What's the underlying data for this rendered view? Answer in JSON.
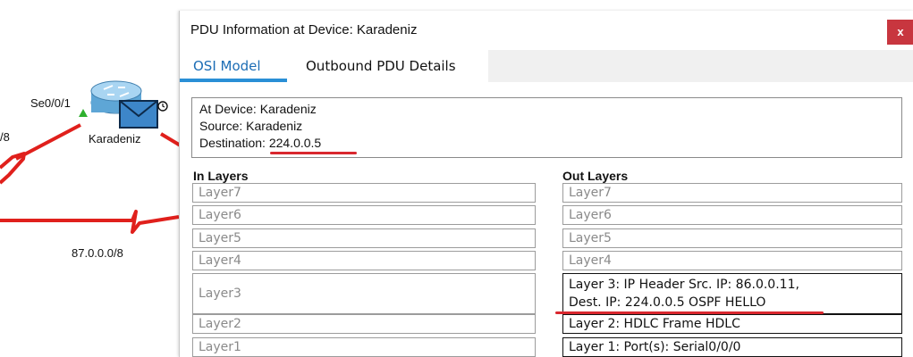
{
  "topology": {
    "interface_label": "Se0/0/1",
    "device_name": "Karadeniz",
    "left_net_label": "/8",
    "network_label": "87.0.0.0/8",
    "colors": {
      "link": "#e0201c",
      "link_endpoint": "#2fb02f",
      "router": "#5ea6d6"
    }
  },
  "dialog": {
    "title": "PDU Information at Device: Karadeniz",
    "close_label": "x",
    "tabs": [
      {
        "label": "OSI Model",
        "active": true
      },
      {
        "label": "Outbound PDU Details",
        "active": false
      }
    ],
    "info": {
      "at_device": "At Device: Karadeniz",
      "source": "Source: Karadeniz",
      "destination_prefix": "Destination:",
      "destination_value": "224.0.0.5"
    },
    "in_layers": {
      "header": "In Layers",
      "items": [
        "Layer7",
        "Layer6",
        "Layer5",
        "Layer4",
        "Layer3",
        "Layer2",
        "Layer1"
      ]
    },
    "out_layers": {
      "header": "Out Layers",
      "items": [
        "Layer7",
        "Layer6",
        "Layer5",
        "Layer4",
        "Layer 3: IP Header Src. IP: 86.0.0.11,",
        "Dest. IP: 224.0.0.5 OSPF HELLO",
        "Layer 2: HDLC Frame HDLC",
        "Layer 1: Port(s): Serial0/0/0"
      ]
    },
    "colors": {
      "accent": "#2a8fd6",
      "annotation": "#d9272e",
      "close": "#c8363f"
    }
  }
}
